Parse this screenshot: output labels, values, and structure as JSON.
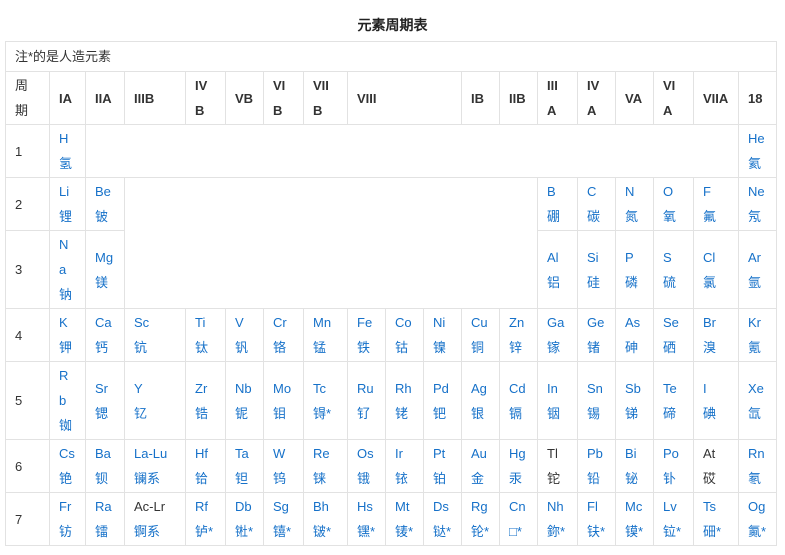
{
  "title": "元素周期表",
  "note": "注*的是人造元素",
  "headers": [
    {
      "label": "周期"
    },
    {
      "label": "IA"
    },
    {
      "label": "IIA"
    },
    {
      "label": "IIIB"
    },
    {
      "label": "IV B"
    },
    {
      "label": "VB"
    },
    {
      "label": "VI B"
    },
    {
      "label": "VII B"
    },
    {
      "label": "VIII",
      "span": 3
    },
    {
      "label": "IB"
    },
    {
      "label": "IIB"
    },
    {
      "label": "III A"
    },
    {
      "label": "IV A"
    },
    {
      "label": "VA"
    },
    {
      "label": "VI A"
    },
    {
      "label": "VIIA"
    },
    {
      "label": "18"
    }
  ],
  "rows": [
    {
      "period": "1",
      "cells": [
        {
          "s": "H",
          "n": "氢"
        },
        {
          "blank": true,
          "span": 16
        },
        {
          "s": "He",
          "n": "氦"
        }
      ]
    },
    {
      "period": "2",
      "cells": [
        {
          "s": "Li",
          "n": "锂"
        },
        {
          "s": "Be",
          "n": "铍"
        },
        {
          "blank": true,
          "span": 10,
          "rowspan": 2
        },
        {
          "s": "B",
          "n": "硼"
        },
        {
          "s": "C",
          "n": "碳"
        },
        {
          "s": "N",
          "n": "氮"
        },
        {
          "s": "O",
          "n": "氧"
        },
        {
          "s": "F",
          "n": "氟"
        },
        {
          "s": "Ne",
          "n": "氖"
        }
      ]
    },
    {
      "period": "3",
      "cells": [
        {
          "s": "Na",
          "n": "钠"
        },
        {
          "s": "Mg",
          "n": "镁"
        },
        {
          "s": "Al",
          "n": "铝"
        },
        {
          "s": "Si",
          "n": "硅"
        },
        {
          "s": "P",
          "n": "磷"
        },
        {
          "s": "S",
          "n": "硫"
        },
        {
          "s": "Cl",
          "n": "氯"
        },
        {
          "s": "Ar",
          "n": "氩"
        }
      ]
    },
    {
      "period": "4",
      "cells": [
        {
          "s": "K",
          "n": "钾"
        },
        {
          "s": "Ca",
          "n": "钙"
        },
        {
          "s": "Sc",
          "n": "钪"
        },
        {
          "s": "Ti",
          "n": "钛"
        },
        {
          "s": "V",
          "n": "钒"
        },
        {
          "s": "Cr",
          "n": "铬"
        },
        {
          "s": "Mn",
          "n": "锰"
        },
        {
          "s": "Fe",
          "n": "铁"
        },
        {
          "s": "Co",
          "n": "钴"
        },
        {
          "s": "Ni",
          "n": "镍"
        },
        {
          "s": "Cu",
          "n": "铜"
        },
        {
          "s": "Zn",
          "n": "锌"
        },
        {
          "s": "Ga",
          "n": "镓"
        },
        {
          "s": "Ge",
          "n": "锗"
        },
        {
          "s": "As",
          "n": "砷"
        },
        {
          "s": "Se",
          "n": "硒"
        },
        {
          "s": "Br",
          "n": "溴"
        },
        {
          "s": "Kr",
          "n": "氪"
        }
      ]
    },
    {
      "period": "5",
      "cells": [
        {
          "s": "Rb",
          "n": "铷"
        },
        {
          "s": "Sr",
          "n": "锶"
        },
        {
          "s": "Y",
          "n": "钇"
        },
        {
          "s": "Zr",
          "n": "锆"
        },
        {
          "s": "Nb",
          "n": "铌"
        },
        {
          "s": "Mo",
          "n": "钼"
        },
        {
          "s": "Tc",
          "n": "锝*"
        },
        {
          "s": "Ru",
          "n": "钌"
        },
        {
          "s": "Rh",
          "n": "铑"
        },
        {
          "s": "Pd",
          "n": "钯"
        },
        {
          "s": "Ag",
          "n": "银"
        },
        {
          "s": "Cd",
          "n": "镉"
        },
        {
          "s": "In",
          "n": "铟"
        },
        {
          "s": "Sn",
          "n": "锡"
        },
        {
          "s": "Sb",
          "n": "锑"
        },
        {
          "s": "Te",
          "n": "碲"
        },
        {
          "s": "I",
          "n": "碘"
        },
        {
          "s": "Xe",
          "n": "氙"
        }
      ]
    },
    {
      "period": "6",
      "cells": [
        {
          "s": "Cs",
          "n": "铯"
        },
        {
          "s": "Ba",
          "n": "钡"
        },
        {
          "s": "La-Lu",
          "n": "镧系"
        },
        {
          "s": "Hf",
          "n": "铪"
        },
        {
          "s": "Ta",
          "n": "钽"
        },
        {
          "s": "W",
          "n": "钨"
        },
        {
          "s": "Re",
          "n": "铼"
        },
        {
          "s": "Os",
          "n": "锇"
        },
        {
          "s": "Ir",
          "n": "铱"
        },
        {
          "s": "Pt",
          "n": "铂"
        },
        {
          "s": "Au",
          "n": "金"
        },
        {
          "s": "Hg",
          "n": "汞"
        },
        {
          "s": "Tl",
          "n": "铊",
          "plain": true
        },
        {
          "s": "Pb",
          "n": "铅"
        },
        {
          "s": "Bi",
          "n": "铋"
        },
        {
          "s": "Po",
          "n": "钋"
        },
        {
          "s": "At",
          "n": "砹",
          "plain": true
        },
        {
          "s": "Rn",
          "n": "氡"
        }
      ]
    },
    {
      "period": "7",
      "cells": [
        {
          "s": "Fr",
          "n": "钫"
        },
        {
          "s": "Ra",
          "n": "镭"
        },
        {
          "s": "Ac-Lr",
          "n": "锕系",
          "symPlain": true
        },
        {
          "s": "Rf",
          "n": "𬬻*"
        },
        {
          "s": "Db",
          "n": "𬭊*"
        },
        {
          "s": "Sg",
          "n": "𬭳*"
        },
        {
          "s": "Bh",
          "n": "𬭛*"
        },
        {
          "s": "Hs",
          "n": "𬭶*"
        },
        {
          "s": "Mt",
          "n": "鿏*"
        },
        {
          "s": "Ds",
          "n": "𫟼*"
        },
        {
          "s": "Rg",
          "n": "𬬭*"
        },
        {
          "s": "Cn",
          "n": "□*"
        },
        {
          "s": "Nh",
          "n": "鉨*"
        },
        {
          "s": "Fl",
          "n": "𫓧*"
        },
        {
          "s": "Mc",
          "n": "镆*"
        },
        {
          "s": "Lv",
          "n": "𫟷*"
        },
        {
          "s": "Ts",
          "n": "鿬*"
        },
        {
          "s": "Og",
          "n": "鿫*"
        }
      ]
    }
  ],
  "colors": {
    "link": "#1671c9",
    "text": "#333333",
    "border": "#e2e2e2"
  }
}
